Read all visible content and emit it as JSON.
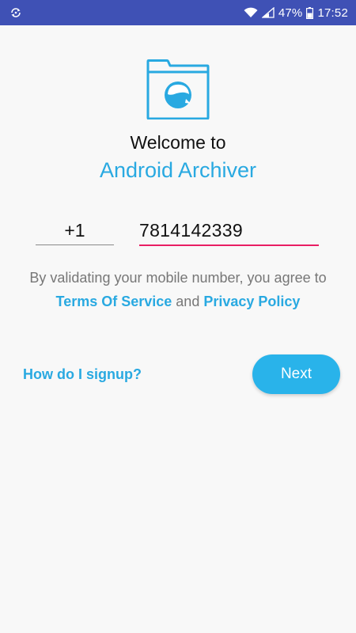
{
  "status_bar": {
    "battery_percent": "47%",
    "time": "17:52",
    "icons": [
      "sync-icon",
      "wifi-icon",
      "cellular-signal-icon",
      "battery-icon"
    ]
  },
  "logo": {
    "icon": "folder-chat-icon",
    "color": "#29a9e1"
  },
  "welcome_text": "Welcome to",
  "app_name": "Android Archiver",
  "phone": {
    "country_code": "+1",
    "number": "7814142339"
  },
  "terms": {
    "prefix": "By validating your mobile number, you agree to ",
    "terms_link": "Terms Of Service",
    "conjunction": " and ",
    "privacy_link": "Privacy Policy"
  },
  "signup_link": "How do I signup?",
  "next_button": "Next",
  "colors": {
    "status_bar": "#3f51b5",
    "accent": "#29a9e1",
    "input_underline_active": "#e91e63",
    "button": "#29b3ea",
    "background": "#f8f8f8"
  }
}
